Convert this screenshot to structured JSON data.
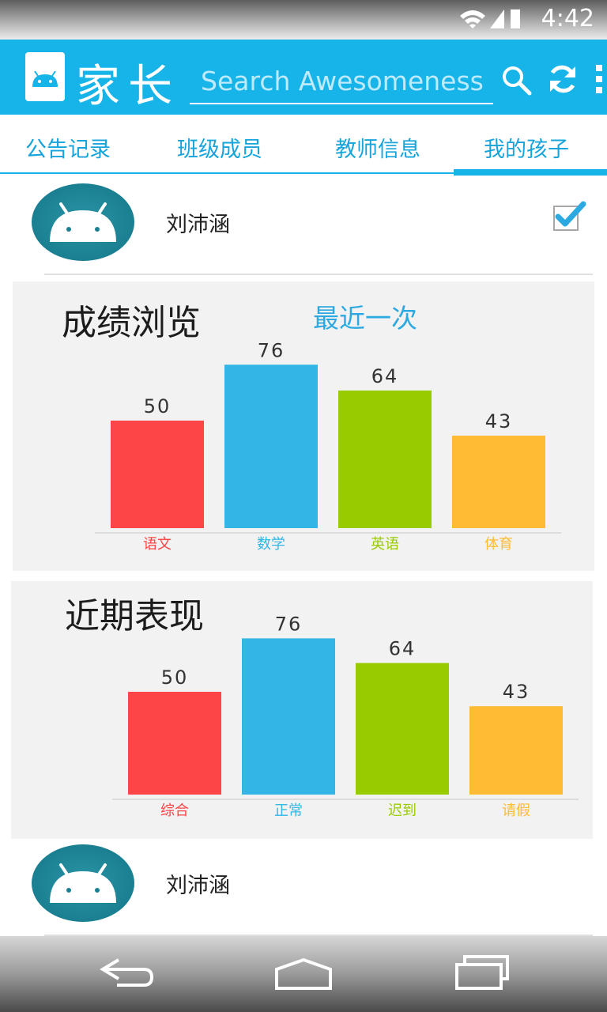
{
  "status_bar": {
    "time": "4:42"
  },
  "action_bar": {
    "title": "家长",
    "search_placeholder": "Search Awesomeness",
    "color": "#17b4ea"
  },
  "tabs": [
    {
      "label": "公告记录",
      "selected": false
    },
    {
      "label": "班级成员",
      "selected": false
    },
    {
      "label": "教师信息",
      "selected": false
    },
    {
      "label": "我的孩子",
      "selected": true
    }
  ],
  "child_list": [
    {
      "name": "刘沛涵",
      "checked": true
    },
    {
      "name": "刘沛涵",
      "checked": false
    }
  ],
  "grades_card": {
    "title": "成绩浏览",
    "link_label": "最近一次"
  },
  "performance_card": {
    "title": "近期表现"
  },
  "chart_data": [
    {
      "type": "bar",
      "title": "成绩浏览",
      "categories": [
        "语文",
        "数学",
        "英语",
        "体育"
      ],
      "values": [
        50,
        76,
        64,
        43
      ],
      "colors": [
        "#fd4446",
        "#33b5e5",
        "#99cc00",
        "#ffbb33"
      ],
      "ylim": [
        0,
        100
      ],
      "grid": false,
      "legend": "none"
    },
    {
      "type": "bar",
      "title": "近期表现",
      "categories": [
        "综合",
        "正常",
        "迟到",
        "请假"
      ],
      "values": [
        50,
        76,
        64,
        43
      ],
      "colors": [
        "#fd4446",
        "#33b5e5",
        "#99cc00",
        "#ffbb33"
      ],
      "ylim": [
        0,
        100
      ],
      "grid": false,
      "legend": "none"
    }
  ],
  "icons": {
    "app": "android-app-icon",
    "search": "search-icon",
    "refresh": "refresh-icon",
    "overflow": "overflow-menu-icon",
    "checkbox": "checkbox-checked-icon",
    "back": "back-icon",
    "home": "home-icon",
    "recents": "recent-apps-icon"
  }
}
